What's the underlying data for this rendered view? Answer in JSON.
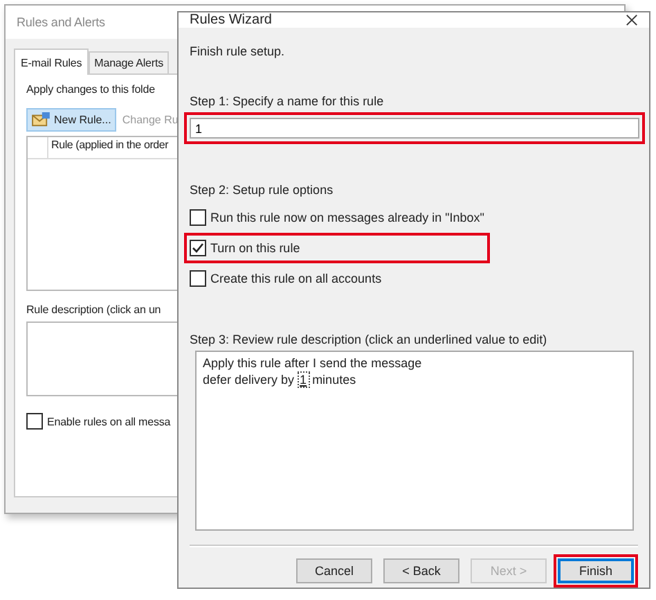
{
  "background_window": {
    "title": "Rules and Alerts",
    "tabs": [
      {
        "label": "E-mail Rules",
        "selected": true
      },
      {
        "label": "Manage Alerts",
        "selected": false
      }
    ],
    "folder_label": "Apply changes to this folde",
    "toolbar": [
      {
        "label": "New Rule...",
        "kind": "new",
        "disabled": false
      },
      {
        "label": "Change Ru",
        "kind": "plain",
        "disabled": true
      }
    ],
    "rule_list": {
      "columns": [
        "Rule (applied in the order"
      ]
    },
    "description_label": "Rule description (click an un",
    "enable_checkbox": {
      "label": "Enable rules on all messa",
      "checked": false
    }
  },
  "dialog": {
    "title": "Rules Wizard",
    "heading": "Finish rule setup.",
    "step1": {
      "label": "Step 1: Specify a name for this rule",
      "value": "1",
      "highlighted": true
    },
    "step2": {
      "label": "Step 2: Setup rule options",
      "options": [
        {
          "label": "Run this rule now on messages already in \"Inbox\"",
          "checked": false,
          "highlighted": false
        },
        {
          "label": "Turn on this rule",
          "checked": true,
          "highlighted": true
        },
        {
          "label": "Create this rule on all accounts",
          "checked": false,
          "highlighted": false
        }
      ]
    },
    "step3": {
      "label": "Step 3: Review rule description (click an underlined value to edit)",
      "description": [
        {
          "parts": [
            {
              "kind": "text",
              "text": "Apply this rule after I send the message"
            }
          ]
        },
        {
          "parts": [
            {
              "kind": "text",
              "text": "defer delivery by"
            },
            {
              "kind": "link",
              "text": "1"
            },
            {
              "kind": "text",
              "text": "minutes"
            }
          ]
        }
      ]
    },
    "buttons": [
      {
        "label": "Cancel",
        "disabled": false,
        "default": false,
        "highlighted": false
      },
      {
        "label": "< Back",
        "disabled": false,
        "default": false,
        "highlighted": false
      },
      {
        "label": "Next >",
        "disabled": true,
        "default": false,
        "highlighted": false
      },
      {
        "label": "Finish",
        "disabled": false,
        "default": true,
        "highlighted": true
      }
    ]
  }
}
